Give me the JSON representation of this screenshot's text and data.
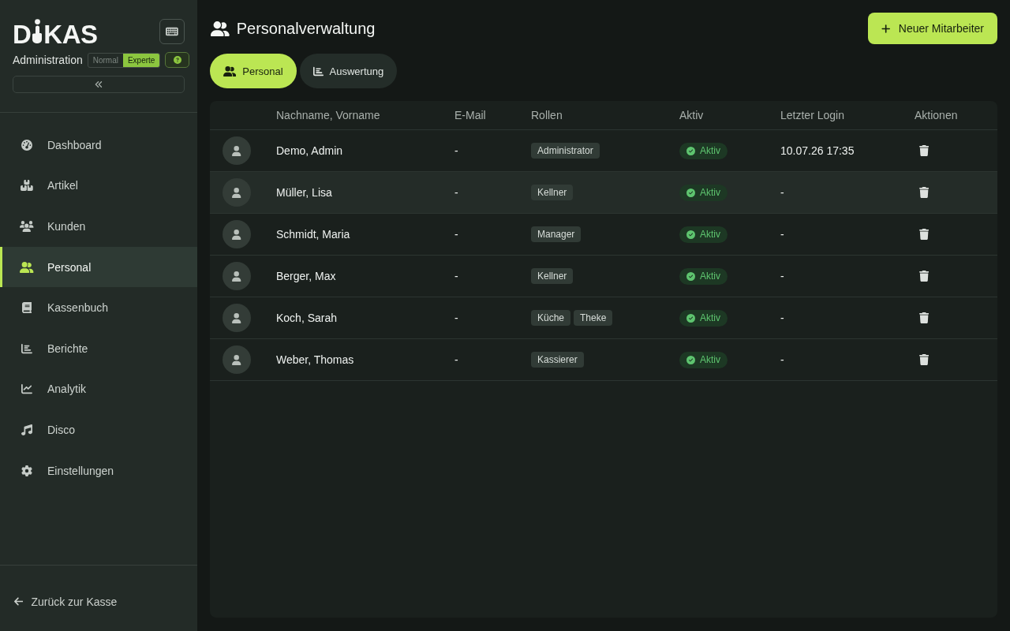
{
  "sidebar": {
    "logo": {
      "lead": "D",
      "tail": "KAS"
    },
    "subtitle": "Administration",
    "mode_toggle": [
      {
        "label": "Normal",
        "selected": false
      },
      {
        "label": "Experte",
        "selected": true
      }
    ],
    "nav": [
      {
        "label": "Dashboard",
        "selected": false
      },
      {
        "label": "Artikel",
        "selected": false
      },
      {
        "label": "Kunden",
        "selected": false
      },
      {
        "label": "Personal",
        "selected": true
      },
      {
        "label": "Kassenbuch",
        "selected": false
      },
      {
        "label": "Berichte",
        "selected": false
      },
      {
        "label": "Analytik",
        "selected": false
      },
      {
        "label": "Disco",
        "selected": false
      },
      {
        "label": "Einstellungen",
        "selected": false
      }
    ],
    "back_link": "Zurück zur Kasse"
  },
  "header": {
    "title": "Personalverwaltung",
    "add_button": "Neuer Mitarbeiter"
  },
  "tabs": [
    {
      "label": "Personal",
      "selected": true
    },
    {
      "label": "Auswertung",
      "selected": false
    }
  ],
  "table": {
    "columns": [
      "Nachname, Vorname",
      "E-Mail",
      "Rollen",
      "Aktiv",
      "Letzter Login",
      "Aktionen"
    ],
    "rows": [
      {
        "name": "Demo, Admin",
        "email": "-",
        "roles": [
          "Administrator"
        ],
        "active": true,
        "status": "Aktiv",
        "last_login": "10.07.26 17:35",
        "highlighted": false
      },
      {
        "name": "Müller, Lisa",
        "email": "-",
        "roles": [
          "Kellner"
        ],
        "active": true,
        "status": "Aktiv",
        "last_login": "-",
        "highlighted": true
      },
      {
        "name": "Schmidt, Maria",
        "email": "-",
        "roles": [
          "Manager"
        ],
        "active": true,
        "status": "Aktiv",
        "last_login": "-",
        "highlighted": false
      },
      {
        "name": "Berger, Max",
        "email": "-",
        "roles": [
          "Kellner"
        ],
        "active": true,
        "status": "Aktiv",
        "last_login": "-",
        "highlighted": false
      },
      {
        "name": "Koch, Sarah",
        "email": "-",
        "roles": [
          "Küche",
          "Theke"
        ],
        "active": true,
        "status": "Aktiv",
        "last_login": "-",
        "highlighted": false
      },
      {
        "name": "Weber, Thomas",
        "email": "-",
        "roles": [
          "Kassierer"
        ],
        "active": true,
        "status": "Aktiv",
        "last_login": "-",
        "highlighted": false
      }
    ]
  }
}
